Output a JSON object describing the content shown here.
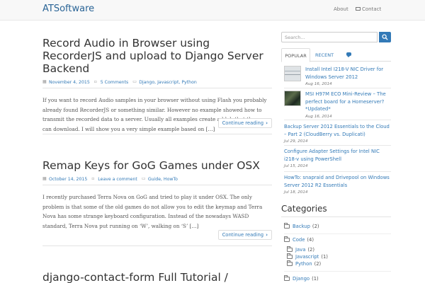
{
  "navbar": {
    "brand": "ATSoftware",
    "links": {
      "about": "About",
      "contact": "Contact"
    }
  },
  "posts": [
    {
      "title": "Record Audio in Browser using RecorderJS and upload to Django Server Backend",
      "date": "November 4, 2015",
      "comments": "5 Comments",
      "tags": "Django, Javascript, Python",
      "excerpt": "If you want to record Audio samples in your browser without using Flash you probably already found RecorderJS or something similar. However no example showed how to transmit the recorded data to a server. Usually all examples create a blob that the user can download. I will show you a very simple example based on […]",
      "continue": "Continue reading"
    },
    {
      "title": "Remap Keys for GoG Games under OSX",
      "date": "October 14, 2015",
      "comments": "Leave a comment",
      "tags": "Guide, HowTo",
      "excerpt": "I recently purchased Terra Nova on GoG and tried to play it under OSX. The only problem is that some of the old games do not allow you to edit the keymap and Terra Nova has some strange keyboard configuration. Instead of the nowadays WASD standard, Terra Nova put running on ‘W’, walking on ‘S’ […]",
      "continue": "Continue reading"
    },
    {
      "title": "django-contact-form Full Tutorial / Custom"
    }
  ],
  "sidebar": {
    "search_placeholder": "Search...",
    "tabs": {
      "popular": "POPULAR",
      "recent": "RECENT"
    },
    "popular": [
      {
        "title": "Install Intel I218-V NIC Driver for Windows Server 2012",
        "date": "Aug 16, 2014"
      },
      {
        "title": "MSI H97M ECO Mini-Review – The perfect board for a Homeserver? *Updated*",
        "date": "Aug 16, 2014"
      },
      {
        "title": "Backup Server 2012 Essentials to the Cloud – Part 2 (CloudBerry vs. Duplicati)",
        "date": "Jul 29, 2014"
      },
      {
        "title": "Configure Adapter Settings for Intel NIC i218-v using PowerShell",
        "date": "Jul 15, 2014"
      },
      {
        "title": "HowTo: snapraid and Drivepool on Windows Server 2012 R2 Essentials",
        "date": "Jul 18, 2014"
      }
    ],
    "categories_heading": "Categories",
    "categories": [
      {
        "name": "Backup",
        "count": "(2)"
      },
      {
        "name": "Code",
        "count": "(4)"
      },
      {
        "name": "Java",
        "count": "(2)"
      },
      {
        "name": "Javascript",
        "count": "(1)"
      },
      {
        "name": "Python",
        "count": "(2)"
      },
      {
        "name": "Django",
        "count": "(1)"
      }
    ]
  },
  "colors": {
    "link": "#337ab7",
    "search_button": "#337ab7",
    "navbar_bg": "#f8f8f8"
  },
  "icons": [
    "calendar-icon",
    "comment-icon",
    "folder-icon",
    "search-icon",
    "envelope-icon",
    "chevron-right-icon",
    "comment-bubble-icon"
  ]
}
